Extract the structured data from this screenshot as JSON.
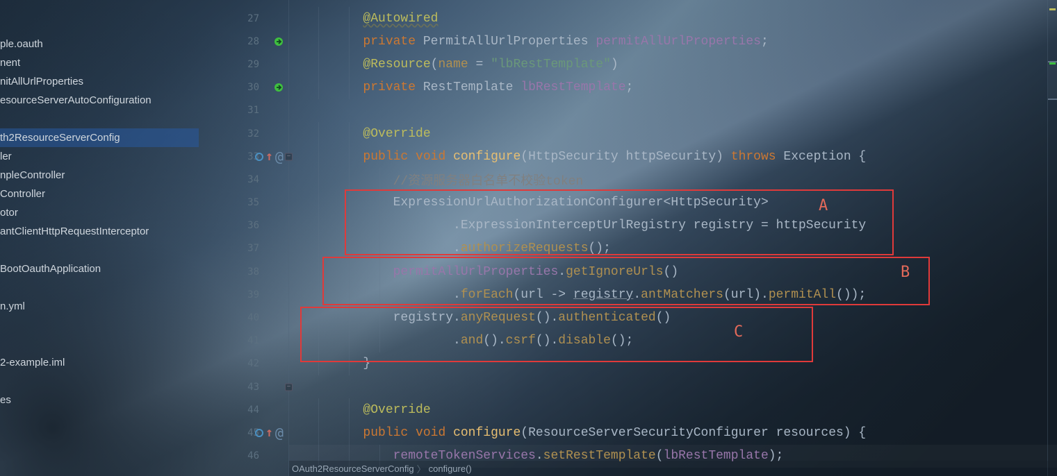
{
  "sidebar": {
    "items": [
      {
        "label": "ple.oauth"
      },
      {
        "label": "nent"
      },
      {
        "label": "nitAllUrlProperties"
      },
      {
        "label": "esourceServerAutoConfiguration"
      },
      {
        "label": ""
      },
      {
        "label": "th2ResourceServerConfig",
        "selected": true
      },
      {
        "label": "ler"
      },
      {
        "label": "npleController"
      },
      {
        "label": "Controller"
      },
      {
        "label": "otor"
      },
      {
        "label": "antClientHttpRequestInterceptor"
      },
      {
        "label": ""
      },
      {
        "label": "BootOauthApplication"
      },
      {
        "label": ""
      },
      {
        "label": "n.yml"
      },
      {
        "label": ""
      },
      {
        "label": ""
      },
      {
        "label": "2-example.iml"
      },
      {
        "label": ""
      },
      {
        "label": "es"
      }
    ]
  },
  "gutter": {
    "start": 27,
    "end": 46,
    "icons": {
      "28": "bean",
      "30": "bean",
      "33": "override",
      "45": "override"
    },
    "folds": [
      33,
      43
    ]
  },
  "code": {
    "27": [
      [
        "ind",
        2
      ],
      [
        "ann",
        "@Autowired",
        "wavy"
      ]
    ],
    "28": [
      [
        "ind",
        2
      ],
      [
        "kw",
        "private"
      ],
      [
        "punct",
        " "
      ],
      [
        "type",
        "PermitAllUrlProperties"
      ],
      [
        "punct",
        " "
      ],
      [
        "field",
        "permitAllUrlProperties"
      ],
      [
        "punct",
        ";"
      ]
    ],
    "29": [
      [
        "ind",
        2
      ],
      [
        "ann",
        "@Resource"
      ],
      [
        "punct",
        "("
      ],
      [
        "field",
        "name"
      ],
      [
        "punct",
        " = "
      ],
      [
        "str",
        "\"lbRestTemplate\""
      ],
      [
        "punct",
        "))"
      ]
    ],
    "29b": [
      [
        "ind",
        2
      ],
      [
        "ann",
        "@Resource"
      ],
      [
        "punct",
        "("
      ],
      [
        "methCall",
        "name"
      ],
      [
        "punct",
        " = "
      ],
      [
        "str",
        "\"lbRestTemplate\""
      ],
      [
        "punct",
        ")"
      ]
    ],
    "30": [
      [
        "ind",
        2
      ],
      [
        "kw",
        "private"
      ],
      [
        "punct",
        " "
      ],
      [
        "type",
        "RestTemplate"
      ],
      [
        "punct",
        " "
      ],
      [
        "field",
        "lbRestTemplate"
      ],
      [
        "punct",
        ";"
      ]
    ],
    "31": [
      [
        "ind",
        0
      ]
    ],
    "32": [
      [
        "ind",
        2
      ],
      [
        "ann",
        "@Override"
      ]
    ],
    "33": [
      [
        "ind",
        2
      ],
      [
        "kw",
        "public"
      ],
      [
        "punct",
        " "
      ],
      [
        "kw",
        "void"
      ],
      [
        "punct",
        " "
      ],
      [
        "meth",
        "configure"
      ],
      [
        "punct",
        "("
      ],
      [
        "type",
        "HttpSecurity"
      ],
      [
        "punct",
        " "
      ],
      [
        "param",
        "httpSecurity"
      ],
      [
        "punct",
        ") "
      ],
      [
        "kw",
        "throws"
      ],
      [
        "punct",
        " "
      ],
      [
        "type",
        "Exception"
      ],
      [
        "punct",
        " {"
      ]
    ],
    "34": [
      [
        "ind",
        3
      ],
      [
        "cmt",
        "//资源服务器白名单不校验token"
      ]
    ],
    "35": [
      [
        "ind",
        3
      ],
      [
        "type",
        "ExpressionUrlAuthorizationConfigurer"
      ],
      [
        "punct",
        "<"
      ],
      [
        "type",
        "HttpSecurity"
      ],
      [
        "punct",
        ">"
      ]
    ],
    "36": [
      [
        "ind",
        5
      ],
      [
        "punct",
        "."
      ],
      [
        "type",
        "ExpressionInterceptUrlRegistry"
      ],
      [
        "punct",
        " "
      ],
      [
        "param",
        "registry"
      ],
      [
        "punct",
        " = "
      ],
      [
        "param",
        "httpSecurity"
      ]
    ],
    "37": [
      [
        "ind",
        5
      ],
      [
        "punct",
        "."
      ],
      [
        "methCall",
        "authorizeRequests"
      ],
      [
        "punct",
        "();"
      ]
    ],
    "38": [
      [
        "ind",
        3
      ],
      [
        "field",
        "permitAllUrlProperties"
      ],
      [
        "punct",
        "."
      ],
      [
        "methCall",
        "getIgnoreUrls"
      ],
      [
        "punct",
        "()"
      ]
    ],
    "39": [
      [
        "ind",
        5
      ],
      [
        "punct",
        "."
      ],
      [
        "methCall",
        "forEach"
      ],
      [
        "punct",
        "("
      ],
      [
        "param",
        "url"
      ],
      [
        "punct",
        " -> "
      ],
      [
        "param",
        "registry",
        "under"
      ],
      [
        "punct",
        "."
      ],
      [
        "methCall",
        "antMatchers"
      ],
      [
        "punct",
        "("
      ],
      [
        "param",
        "url"
      ],
      [
        "punct",
        ")."
      ],
      [
        "methCall",
        "permitAll"
      ],
      [
        "punct",
        "());"
      ]
    ],
    "40": [
      [
        "ind",
        3
      ],
      [
        "param",
        "registry"
      ],
      [
        "punct",
        "."
      ],
      [
        "methCall",
        "anyRequest"
      ],
      [
        "punct",
        "()."
      ],
      [
        "methCall",
        "authenticated"
      ],
      [
        "punct",
        "()"
      ]
    ],
    "41": [
      [
        "ind",
        5
      ],
      [
        "punct",
        "."
      ],
      [
        "methCall",
        "and"
      ],
      [
        "punct",
        "()."
      ],
      [
        "methCall",
        "csrf"
      ],
      [
        "punct",
        "()."
      ],
      [
        "methCall",
        "disable"
      ],
      [
        "punct",
        "();"
      ]
    ],
    "42": [
      [
        "ind",
        2
      ],
      [
        "punct",
        "}"
      ]
    ],
    "43": [
      [
        "ind",
        0
      ]
    ],
    "44": [
      [
        "ind",
        2
      ],
      [
        "ann",
        "@Override"
      ]
    ],
    "45": [
      [
        "ind",
        2
      ],
      [
        "kw",
        "public"
      ],
      [
        "punct",
        " "
      ],
      [
        "kw",
        "void"
      ],
      [
        "punct",
        " "
      ],
      [
        "meth",
        "configure"
      ],
      [
        "punct",
        "("
      ],
      [
        "type",
        "ResourceServerSecurityConfigurer"
      ],
      [
        "punct",
        " "
      ],
      [
        "param",
        "resources"
      ],
      [
        "punct",
        ") {"
      ]
    ],
    "46": [
      [
        "ind",
        3
      ],
      [
        "field",
        "remoteTokenServices"
      ],
      [
        "punct",
        "."
      ],
      [
        "methCall",
        "setRestTemplate"
      ],
      [
        "punct",
        "("
      ],
      [
        "field",
        "lbRestTemplate"
      ],
      [
        "punct",
        ");"
      ]
    ]
  },
  "annotations": {
    "A": "A",
    "B": "B",
    "C": "C"
  },
  "breadcrumb": {
    "class": "OAuth2ResourceServerConfig",
    "method": "configure()"
  }
}
